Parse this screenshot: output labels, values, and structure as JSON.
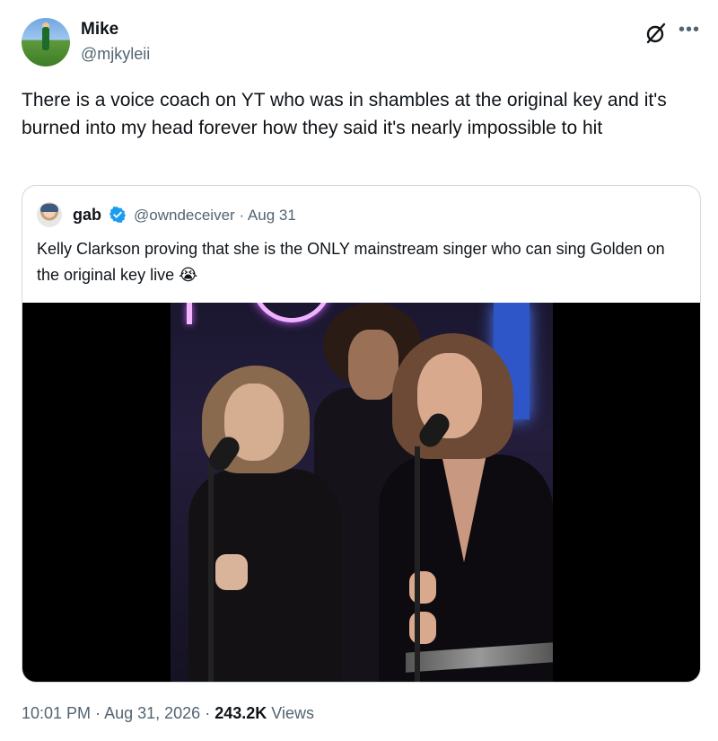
{
  "tweet": {
    "author_name": "Mike",
    "author_handle": "@mjkyleii",
    "text": "There is a voice coach on YT who was in shambles at the original key and it's burned into my head forever how they said it's nearly impossible to hit",
    "time": "10:01 PM",
    "sep1": "·",
    "date": "Aug 31, 2026",
    "sep2": "·",
    "views_count": "243.2K",
    "views_label": "Views"
  },
  "quoted_tweet": {
    "author_name": "gab",
    "author_handle": "@owndeceiver",
    "sep": "·",
    "date": "Aug 31",
    "text": "Kelly Clarkson proving that she is the ONLY mainstream singer who can sing Golden on the original key live 😭"
  },
  "icons": {
    "more": "more-icon",
    "grok": "grok-icon",
    "verified": "verified-badge-icon"
  },
  "colors": {
    "text_primary": "#0f1419",
    "text_secondary": "#536471",
    "border": "#cfd9de",
    "verified_blue": "#1d9bf0"
  }
}
